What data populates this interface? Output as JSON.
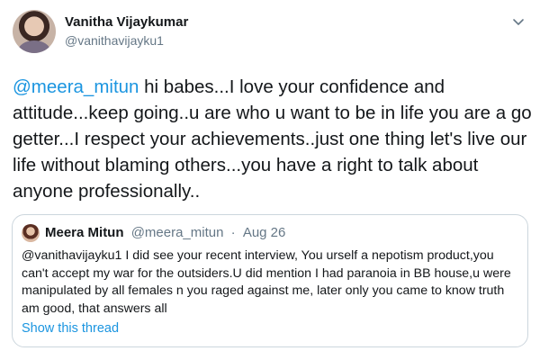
{
  "author": {
    "name": "Vanitha Vijaykumar",
    "handle": "@vanithavijayku1"
  },
  "tweet": {
    "mention": "@meera_mitun",
    "text": " hi babes...I love your confidence and attitude...keep going..u are who u want to be in life you are a go getter...I respect your achievements..just one thing let's live our life without blaming others...you have a right to talk about anyone professionally.."
  },
  "quoted_tweet": {
    "name": "Meera Mitun",
    "handle": "@meera_mitun",
    "separator": "·",
    "date": "Aug 26",
    "text": "@vanithavijayku1 I did see your recent interview, You urself a nepotism product,you can't accept my war for the outsiders.U did mention I had paranoia in BB house,u were manipulated by all females n you raged against me, later only you came to know truth am good, that answers all",
    "show_thread_label": "Show this thread"
  },
  "colors": {
    "link": "#1b95e0",
    "secondary_text": "#657786",
    "border": "#ccd6dd"
  },
  "icons": {
    "menu": "chevron-down-icon"
  }
}
